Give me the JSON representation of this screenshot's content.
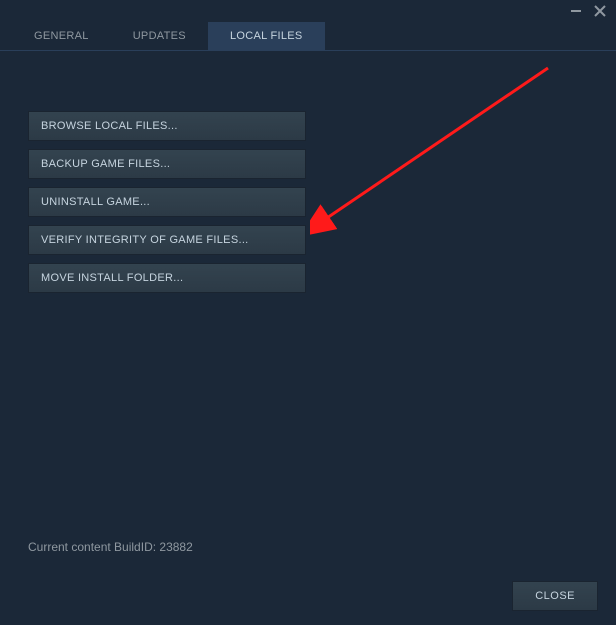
{
  "tabs": {
    "general": "GENERAL",
    "updates": "UPDATES",
    "localFiles": "LOCAL FILES"
  },
  "actions": {
    "browse": "BROWSE LOCAL FILES...",
    "backup": "BACKUP GAME FILES...",
    "uninstall": "UNINSTALL GAME...",
    "verify": "VERIFY INTEGRITY OF GAME FILES...",
    "move": "MOVE INSTALL FOLDER..."
  },
  "buildInfo": "Current content BuildID: 23882",
  "footer": {
    "close": "CLOSE"
  }
}
